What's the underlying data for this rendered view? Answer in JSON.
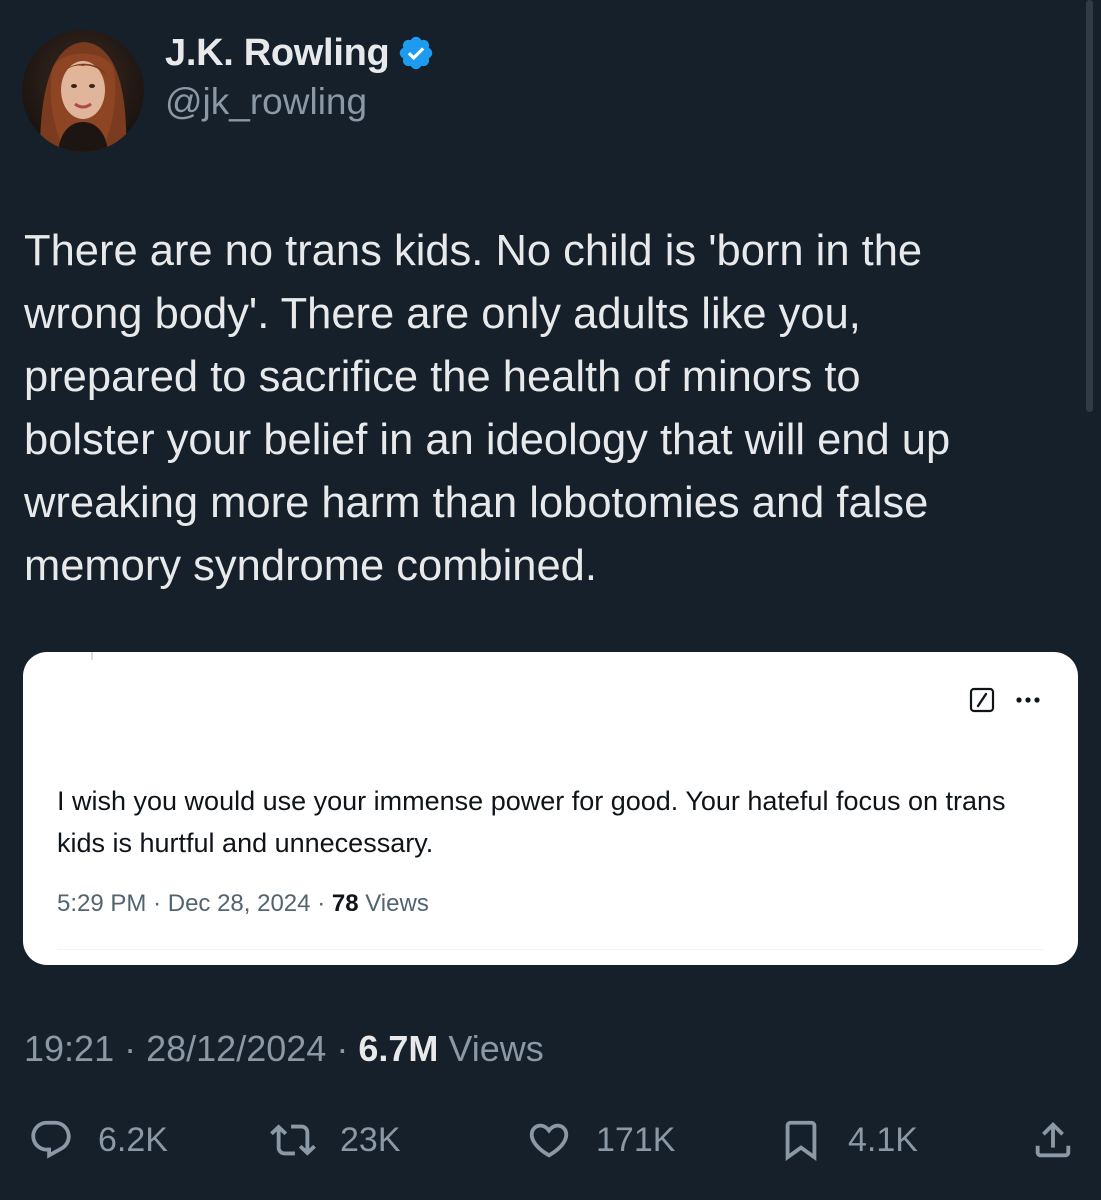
{
  "author": {
    "display_name": "J.K. Rowling",
    "handle": "@jk_rowling",
    "verified": true
  },
  "tweet": {
    "text": "There are no trans kids. No child is 'born in the\nwrong body'. There are only adults like you,\nprepared to sacrifice the health of minors to\nbolster your belief in an ideology that will end up\nwreaking more harm than lobotomies and false\nmemory syndrome combined."
  },
  "quoted": {
    "text": "I wish you would use your immense power for good. Your hateful focus on trans kids is hurtful and unnecessary.",
    "time": "5:29 PM",
    "date": "Dec 28, 2024",
    "views_count": "78",
    "views_label": "Views"
  },
  "meta": {
    "time": "19:21",
    "date": "28/12/2024",
    "views_count": "6.7M",
    "views_label": "Views"
  },
  "actions": {
    "replies": "6.2K",
    "reposts": "23K",
    "likes": "171K",
    "bookmarks": "4.1K"
  },
  "icons": {
    "verified": "verified-badge-icon",
    "reply": "reply-icon",
    "repost": "repost-icon",
    "like": "like-icon",
    "bookmark": "bookmark-icon",
    "share": "share-icon",
    "edit": "edit-icon",
    "more": "more-icon"
  },
  "colors": {
    "background": "#15202b",
    "text_primary": "#e7e9ea",
    "text_secondary": "#8b98a5",
    "verified_blue": "#1d9bf0",
    "card_background": "#ffffff"
  }
}
